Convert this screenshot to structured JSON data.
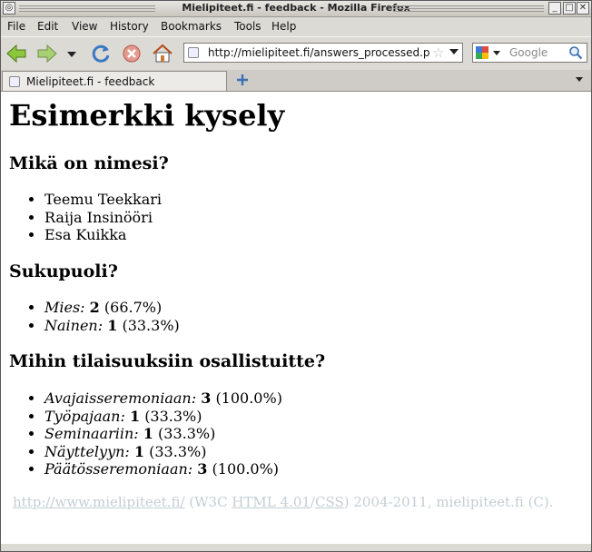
{
  "window": {
    "title": "Mielipiteet.fi - feedback - Mozilla Firefox"
  },
  "menubar": {
    "items": [
      "File",
      "Edit",
      "View",
      "History",
      "Bookmarks",
      "Tools",
      "Help"
    ]
  },
  "navbar": {
    "url": "http://mielipiteet.fi/answers_processed.p",
    "search_placeholder": "Google"
  },
  "tabs": [
    {
      "label": "Mielipiteet.fi - feedback"
    }
  ],
  "page": {
    "heading": "Esimerkki kysely",
    "questions": [
      {
        "title": "Mikä on nimesi?",
        "answers": [
          {
            "text": "Teemu Teekkari"
          },
          {
            "text": "Raija Insinööri"
          },
          {
            "text": "Esa Kuikka"
          }
        ]
      },
      {
        "title": "Sukupuoli?",
        "answers": [
          {
            "label": "Mies:",
            "count": "2",
            "percent": "(66.7%)"
          },
          {
            "label": "Nainen:",
            "count": "1",
            "percent": "(33.3%)"
          }
        ]
      },
      {
        "title": "Mihin tilaisuuksiin osallistuitte?",
        "answers": [
          {
            "label": "Avajaisseremoniaan:",
            "count": "3",
            "percent": "(100.0%)"
          },
          {
            "label": "Työpajaan:",
            "count": "1",
            "percent": "(33.3%)"
          },
          {
            "label": "Seminaariin:",
            "count": "1",
            "percent": "(33.3%)"
          },
          {
            "label": "Näyttelyyn:",
            "count": "1",
            "percent": "(33.3%)"
          },
          {
            "label": "Päätösseremoniaan:",
            "count": "3",
            "percent": "(100.0%)"
          }
        ]
      }
    ],
    "footer": {
      "link": "http://www.mielipiteet.fi/",
      "text_a": " (W3C ",
      "html_link": "HTML 4.01",
      "sep": "/",
      "css_link": "CSS",
      "text_b": ") 2004-2011, mielipiteet.fi (C)."
    }
  }
}
